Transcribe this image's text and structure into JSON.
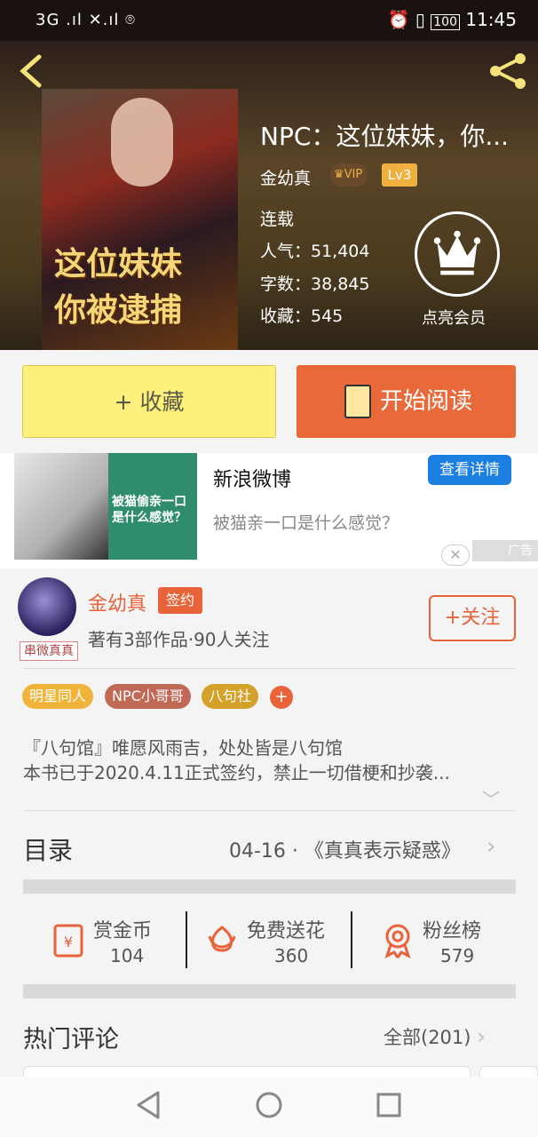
{
  "status_bar": {
    "left": "3G .ıl ✕.ıl  ⌾",
    "time": "11:45",
    "battery": "100"
  },
  "book": {
    "title": "NPC：这位妹妹，你...",
    "author": "金幼真",
    "vip": "VIP",
    "level": "Lv3",
    "status": "连载",
    "popularity": "人气：51,404",
    "words": "字数：38,845",
    "favorites": "收藏：545",
    "cover_title_1": "这位妹妹",
    "cover_title_2": "你被逮捕"
  },
  "member": {
    "label": "点亮会员"
  },
  "buttons": {
    "collect": "+ 收藏",
    "read": "开始阅读"
  },
  "ad": {
    "title": "新浪微博",
    "detail": "查看详情",
    "desc": "被猫亲一口是什么感觉？",
    "image_text": "被猫偷亲一口是什么感觉？",
    "close": "✕",
    "mark": "广告"
  },
  "author": {
    "name": "金幼真",
    "badge": "签约",
    "info": "著有3部作品·90人关注",
    "follow": "+关注",
    "avatar_tag": "串微真真"
  },
  "tags": [
    {
      "label": "明星同人",
      "color": "#f0b43a"
    },
    {
      "label": "NPC小哥哥",
      "color": "#c06a55"
    },
    {
      "label": "八句社",
      "color": "#d4a12a"
    }
  ],
  "tag_add": "+",
  "intro": {
    "line1": "『八句馆』唯愿风雨吉，处处皆是八句馆",
    "line2": "本书已于2020.4.11正式签约，禁止一切借梗和抄袭..."
  },
  "toc": {
    "label": "目录",
    "latest": "04-16 · 《真真表示疑惑》"
  },
  "stats": [
    {
      "label": "赏金币",
      "value": "104"
    },
    {
      "label": "免费送花",
      "value": "360"
    },
    {
      "label": "粉丝榜",
      "value": "579"
    }
  ],
  "comments": {
    "label": "热门评论",
    "all": "全部(201)"
  },
  "colors": {
    "accent": "#e8633a",
    "collect": "#fdf07c"
  }
}
